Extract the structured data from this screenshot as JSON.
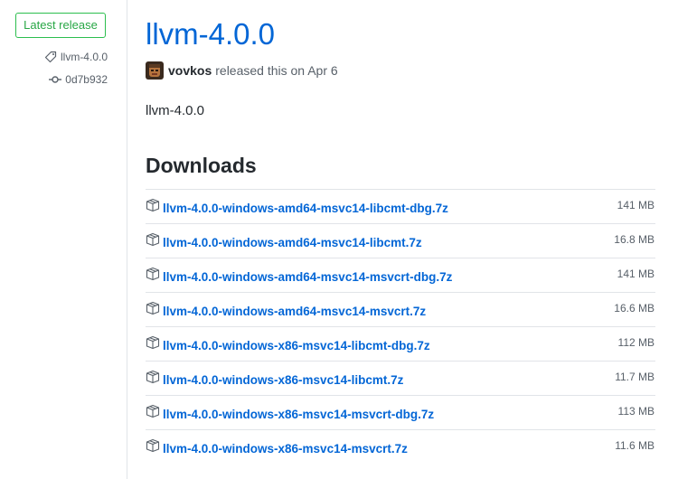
{
  "sidebar": {
    "badge_label": "Latest release",
    "tag": {
      "icon": "tag-icon",
      "label": "llvm-4.0.0"
    },
    "commit": {
      "icon": "git-commit-icon",
      "label": "0d7b932"
    }
  },
  "release": {
    "title": "llvm-4.0.0",
    "author": "vovkos",
    "released_text": "released this on Apr 6",
    "body": "llvm-4.0.0"
  },
  "downloads": {
    "heading": "Downloads",
    "items": [
      {
        "name": "llvm-4.0.0-windows-amd64-msvc14-libcmt-dbg.7z",
        "size": "141 MB"
      },
      {
        "name": "llvm-4.0.0-windows-amd64-msvc14-libcmt.7z",
        "size": "16.8 MB"
      },
      {
        "name": "llvm-4.0.0-windows-amd64-msvc14-msvcrt-dbg.7z",
        "size": "141 MB"
      },
      {
        "name": "llvm-4.0.0-windows-amd64-msvc14-msvcrt.7z",
        "size": "16.6 MB"
      },
      {
        "name": "llvm-4.0.0-windows-x86-msvc14-libcmt-dbg.7z",
        "size": "112 MB"
      },
      {
        "name": "llvm-4.0.0-windows-x86-msvc14-libcmt.7z",
        "size": "11.7 MB"
      },
      {
        "name": "llvm-4.0.0-windows-x86-msvc14-msvcrt-dbg.7z",
        "size": "113 MB"
      },
      {
        "name": "llvm-4.0.0-windows-x86-msvc14-msvcrt.7z",
        "size": "11.6 MB"
      }
    ]
  },
  "colors": {
    "link": "#0366d6",
    "green": "#28a745",
    "muted": "#586069",
    "border": "#e1e4e8"
  }
}
